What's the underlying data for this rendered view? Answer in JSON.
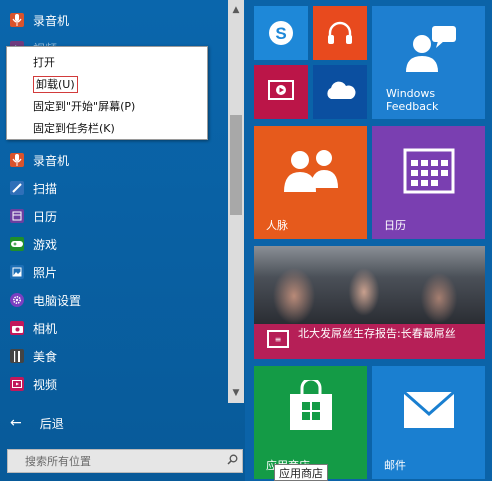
{
  "apps": [
    {
      "label": "录音机",
      "icon": "microphone-icon",
      "color": "#d9532c"
    },
    {
      "label": "视频",
      "icon": "video-icon",
      "color": "#c2185b"
    },
    {
      "label": "录音机",
      "icon": "microphone-icon",
      "color": "#d9532c"
    },
    {
      "label": "扫描",
      "icon": "scan-icon",
      "color": "#2f6fb8"
    },
    {
      "label": "日历",
      "icon": "calendar-icon",
      "color": "#6b3fa0"
    },
    {
      "label": "游戏",
      "icon": "game-controller-icon",
      "color": "#1f8f2a"
    },
    {
      "label": "照片",
      "icon": "photos-icon",
      "color": "#1d6fb5"
    },
    {
      "label": "电脑设置",
      "icon": "gear-icon",
      "color": "#7a3fc0"
    },
    {
      "label": "相机",
      "icon": "camera-icon",
      "color": "#c2185b"
    },
    {
      "label": "美食",
      "icon": "food-icon",
      "color": "#444444"
    },
    {
      "label": "视频",
      "icon": "video-icon",
      "color": "#c2185b"
    }
  ],
  "context_menu": {
    "items": [
      {
        "label": "打开"
      },
      {
        "label": "卸载(U)"
      },
      {
        "label": "固定到\"开始\"屏幕(P)"
      },
      {
        "label": "固定到任务栏(K)"
      }
    ]
  },
  "back_label": "后退",
  "search": {
    "placeholder": "搜索所有位置",
    "icon": "search-icon"
  },
  "tiles": {
    "skype": {
      "icon": "skype-icon",
      "color": "#1e88d8"
    },
    "music": {
      "icon": "headphones-icon",
      "color": "#e84a1e"
    },
    "video": {
      "icon": "video-player-icon",
      "color": "#bb1548"
    },
    "onedrive": {
      "icon": "cloud-icon",
      "color": "#0b4fa0"
    },
    "feedback": {
      "label": "Windows Feedback",
      "icon": "feedback-icon",
      "color": "#1e7fd0"
    },
    "people": {
      "label": "人脉",
      "icon": "people-icon",
      "color": "#e65a1c"
    },
    "calendar": {
      "label": "日历",
      "icon": "calendar-icon",
      "color": "#7a3fb1"
    },
    "news": {
      "title": "北大发屌丝生存报告:长春最屌丝",
      "color": "#b61f57",
      "icon": "news-icon"
    },
    "store": {
      "label": "应用商店",
      "icon": "store-icon",
      "color": "#149b46"
    },
    "mail": {
      "label": "邮件",
      "icon": "mail-icon",
      "color": "#1a7fd0"
    }
  },
  "tooltip": "应用商店"
}
